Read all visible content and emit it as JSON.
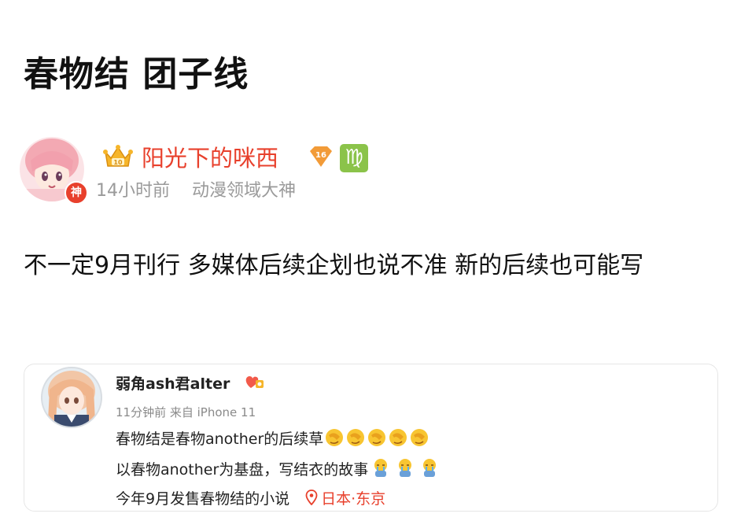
{
  "page_title": "春物结 团子线",
  "post": {
    "author": "阳光下的咪西",
    "author_badge": "神",
    "level": "16",
    "zodiac_glyph": "♍",
    "time": "14小时前",
    "author_title": "动漫领域大神",
    "content": "不一定9月刊行 多媒体后续企划也说不准 新的后续也可能写"
  },
  "quoted": {
    "author": "弱角ash君alter",
    "time": "11分钟前",
    "source": "来自 iPhone 11",
    "line1": "春物结是春物another的后续草",
    "line2": "以春物another为基盘，写结衣的故事",
    "line3": "今年9月发售春物结的小说",
    "location": "日本·东京",
    "line1_emoji_count": 5,
    "line2_emoji_count": 3
  },
  "colors": {
    "username": "#e8402c",
    "meta_gray": "#9a9a9a",
    "zodiac_bg": "#8bc34a",
    "level_badge": "#f29b38"
  }
}
